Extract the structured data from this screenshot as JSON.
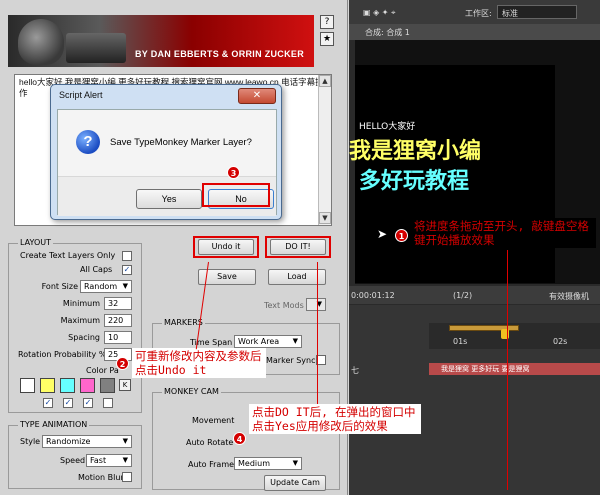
{
  "banner": {
    "credit": "BY DAN EBBERTS & ORRIN ZUCKER",
    "help_label": "?",
    "fav_label": "★"
  },
  "script_text": "hello大家好 我是狸窝小编 更多好玩教程 搜索狸窝官网 www.leawo.cn 电话字幕操作",
  "dialog": {
    "title": "Script Alert",
    "close_label": "✕",
    "message": "Save TypeMonkey Marker Layer?",
    "yes_label": "Yes",
    "no_label": "No"
  },
  "layout": {
    "title": "LAYOUT",
    "create_text_layers_only": "Create Text Layers Only",
    "all_caps": "All Caps",
    "font_size_label": "Font Size",
    "font_size_value": "Random",
    "minimum_label": "Minimum",
    "minimum_value": "32",
    "maximum_label": "Maximum",
    "maximum_value": "220",
    "spacing_label": "Spacing",
    "spacing_value": "10",
    "rotation_label": "Rotation Probability %",
    "rotation_value": "25",
    "color_palette_label": "Color Pa",
    "colors": [
      "#ffffff",
      "#ffff66",
      "#66ffff",
      "#ff66cc",
      "#808080"
    ],
    "k_label": "K"
  },
  "type_animation": {
    "title": "TYPE ANIMATION",
    "style_label": "Style",
    "style_value": "Randomize",
    "speed_label": "Speed",
    "speed_value": "Fast",
    "motion_blur_label": "Motion Blur"
  },
  "buttons": {
    "undo": "Undo it",
    "do_it": "DO IT!",
    "save": "Save",
    "load": "Load",
    "text_mods": "Text Mods"
  },
  "markers": {
    "title": "MARKERS",
    "time_span_label": "Time Span",
    "time_span_value": "Work Area",
    "marker_sync_label": "Marker Sync"
  },
  "monkey_cam": {
    "title": "MONKEY CAM",
    "movement_label": "Movement",
    "auto_rotate_label": "Auto Rotate",
    "auto_frame_label": "Auto Frame",
    "auto_frame_value": "Medium",
    "update_cam_label": "Update Cam"
  },
  "ae": {
    "workspace_label": "工作区:",
    "workspace_value": "标准",
    "comp_tab": "合成: 合成 1",
    "preview_line1": "HELLO大家好",
    "preview_line2": "我是狸窝小编",
    "preview_line3": "多好玩教程",
    "timecode": "0:00:01:12",
    "quality": "(1/2)",
    "camera": "有效摄像机",
    "ruler_1": "01s",
    "ruler_2": "02s",
    "clip_labels": "我是狸窝  更多好玩  要是狸窝"
  },
  "annotations": {
    "a1": "将进度条拖动至开头, 敲键盘空格键开始播放效果",
    "a2": "可重新修改内容及参数后点击Undo it",
    "a3": "",
    "a4": "点击DO IT后, 在弹出的窗口中点击Yes应用修改后的效果",
    "n1": "1",
    "n2": "2",
    "n3": "3",
    "n4": "4"
  }
}
